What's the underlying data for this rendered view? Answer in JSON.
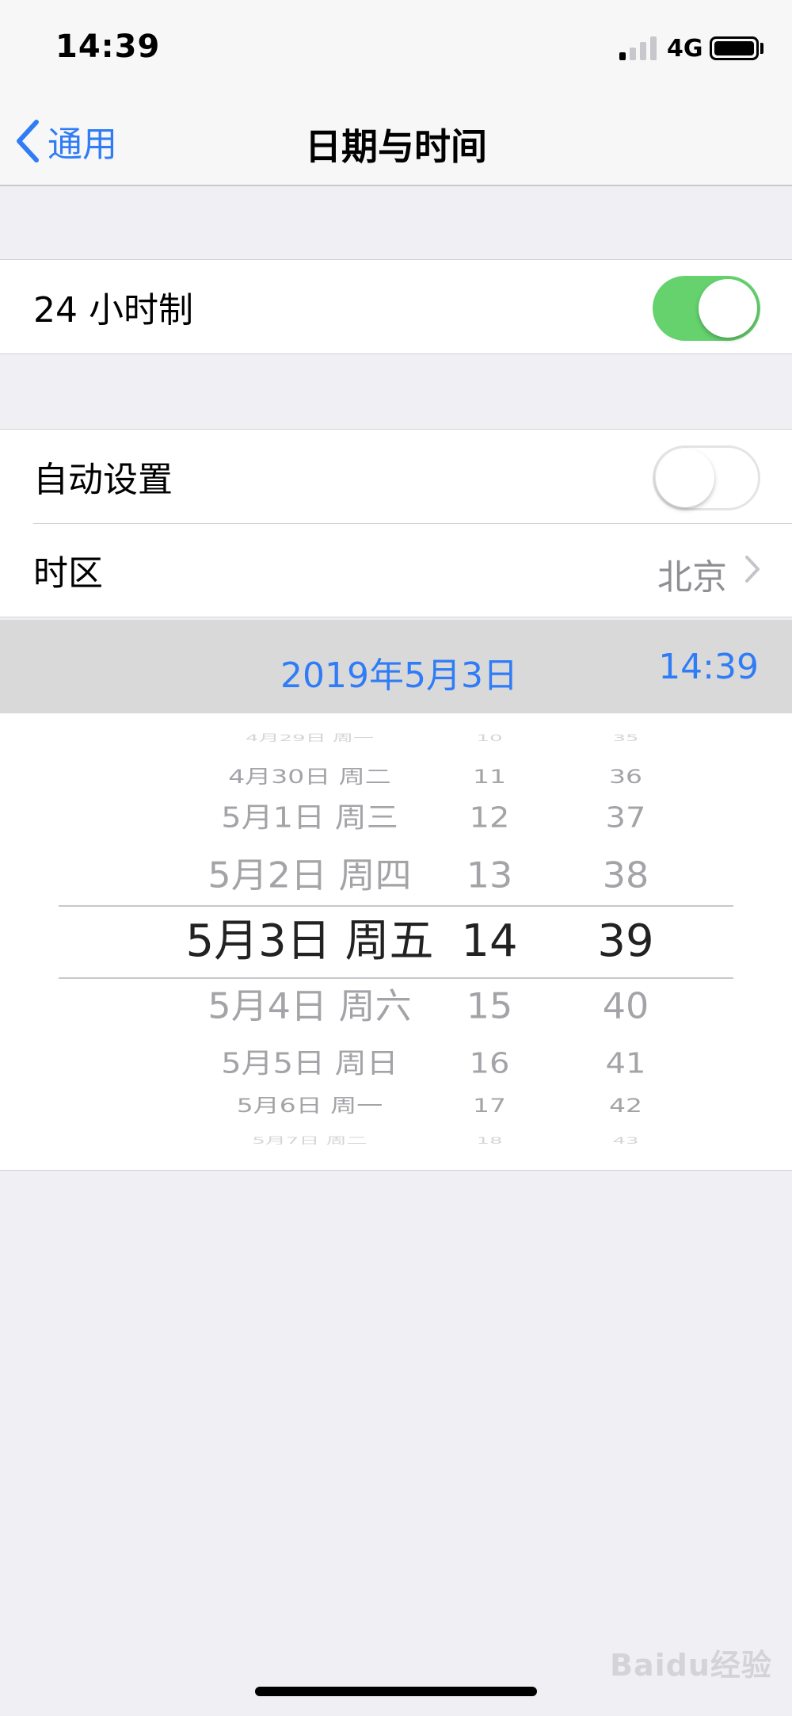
{
  "status_bar": {
    "time": "14:39",
    "network": "4G",
    "signal_bars_active": 1,
    "signal_bars_total": 4,
    "battery_level": 1.0
  },
  "nav": {
    "back_label": "通用",
    "title": "日期与时间"
  },
  "settings": {
    "hour24": {
      "label": "24 小时制",
      "enabled": true
    },
    "auto_set": {
      "label": "自动设置",
      "enabled": false
    },
    "timezone": {
      "label": "时区",
      "value": "北京"
    }
  },
  "date_row": {
    "date": "2019年5月3日",
    "time": "14:39"
  },
  "picker": {
    "days": [
      "4月29日 周一",
      "4月30日 周二",
      "5月1日 周三",
      "5月2日 周四",
      "5月3日 周五",
      "5月4日 周六",
      "5月5日 周日",
      "5月6日 周一",
      "5月7日 周二"
    ],
    "hours": [
      "10",
      "11",
      "12",
      "13",
      "14",
      "15",
      "16",
      "17",
      "18"
    ],
    "minutes": [
      "35",
      "36",
      "37",
      "38",
      "39",
      "40",
      "41",
      "42",
      "43"
    ],
    "selected_index": 4
  },
  "watermark": "Baidu经验",
  "colors": {
    "accent": "#2f7cf6",
    "toggle_on": "#65d26e",
    "background": "#efeff4"
  }
}
